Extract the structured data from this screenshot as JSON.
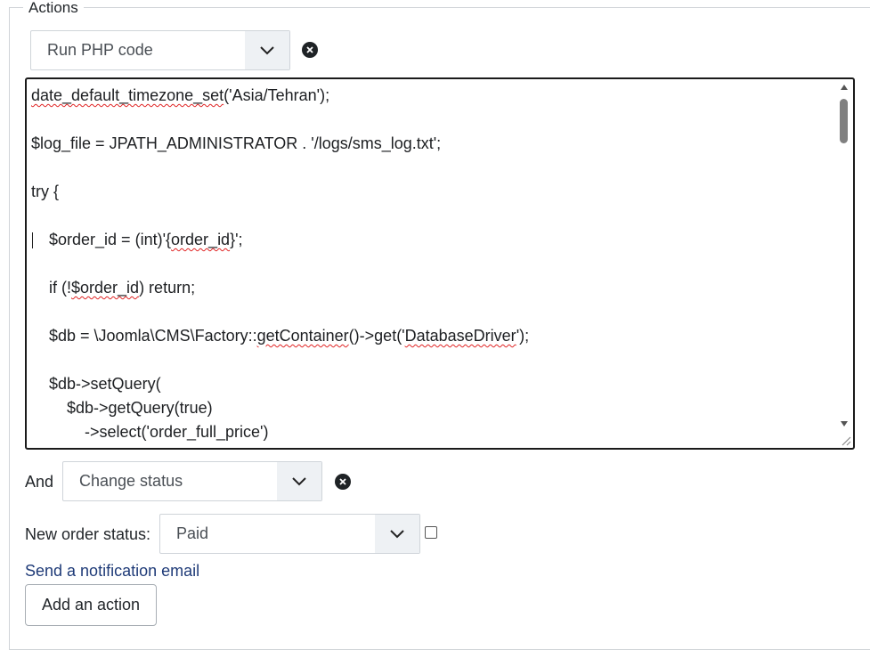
{
  "actions": {
    "legend": "Actions",
    "first_action": {
      "select_value": "Run PHP code",
      "code_lines": [
        "date_default_timezone_set('Asia/Tehran');",
        "",
        "$log_file = JPATH_ADMINISTRATOR . '/logs/sms_log.txt';",
        "",
        "try {",
        "",
        "    $order_id = (int)'{order_id}';",
        "",
        "    if (!$order_id) return;",
        "",
        "    $db = \\Joomla\\CMS\\Factory::getContainer()->get('DatabaseDriver');",
        "",
        "    $db->setQuery(",
        "        $db->getQuery(true)",
        "            ->select('order_full_price')"
      ]
    },
    "second_action": {
      "connector": "And",
      "select_value": "Change status",
      "status_label": "New order status:",
      "status_value": "Paid"
    },
    "notification_link": "Send a notification email",
    "add_button": "Add an action"
  }
}
